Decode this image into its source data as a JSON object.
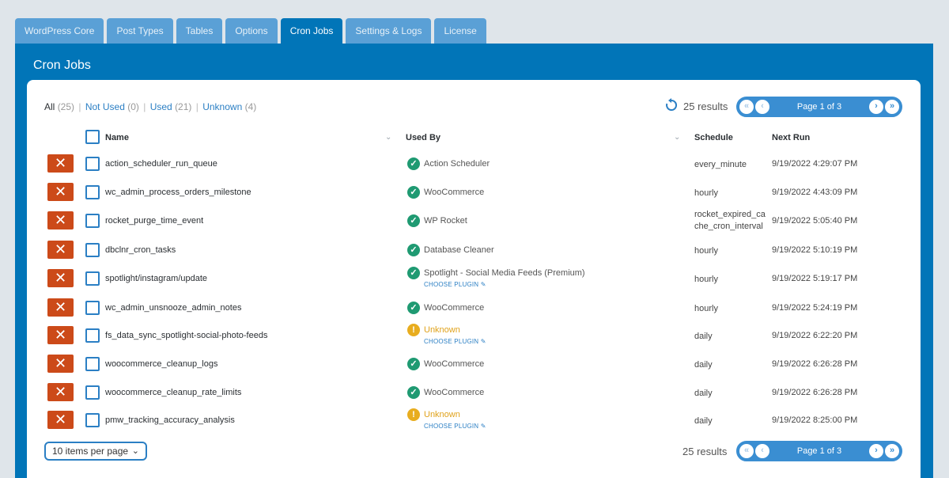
{
  "tabs": [
    {
      "label": "WordPress Core",
      "active": false
    },
    {
      "label": "Post Types",
      "active": false
    },
    {
      "label": "Tables",
      "active": false
    },
    {
      "label": "Options",
      "active": false
    },
    {
      "label": "Cron Jobs",
      "active": true
    },
    {
      "label": "Settings & Logs",
      "active": false
    },
    {
      "label": "License",
      "active": false
    }
  ],
  "panel": {
    "title": "Cron Jobs"
  },
  "filters": {
    "all": "All",
    "all_count": "(25)",
    "not_used": "Not Used",
    "not_used_count": "(0)",
    "used": "Used",
    "used_count": "(21)",
    "unknown": "Unknown",
    "unknown_count": "(4)",
    "sep": "|"
  },
  "results_text": "25 results",
  "pager": {
    "label": "Page 1 of 3",
    "first": "«",
    "prev": "‹",
    "next": "›",
    "last": "»"
  },
  "columns": {
    "name": "Name",
    "used_by": "Used By",
    "schedule": "Schedule",
    "next_run": "Next Run"
  },
  "choose_plugin_label": "CHOOSE PLUGIN ✎",
  "rows": [
    {
      "name": "action_scheduler_run_queue",
      "used_by": "Action Scheduler",
      "status": "ok",
      "schedule": "every_minute",
      "next_run": "9/19/2022 4:29:07 PM"
    },
    {
      "name": "wc_admin_process_orders_milestone",
      "used_by": "WooCommerce",
      "status": "ok",
      "schedule": "hourly",
      "next_run": "9/19/2022 4:43:09 PM"
    },
    {
      "name": "rocket_purge_time_event",
      "used_by": "WP Rocket",
      "status": "ok",
      "schedule": "rocket_expired_cache_cron_interval",
      "next_run": "9/19/2022 5:05:40 PM"
    },
    {
      "name": "dbclnr_cron_tasks",
      "used_by": "Database Cleaner",
      "status": "ok",
      "schedule": "hourly",
      "next_run": "9/19/2022 5:10:19 PM"
    },
    {
      "name": "spotlight/instagram/update",
      "used_by": "Spotlight - Social Media Feeds (Premium)",
      "status": "ok",
      "schedule": "hourly",
      "next_run": "9/19/2022 5:19:17 PM",
      "choose": true
    },
    {
      "name": "wc_admin_unsnooze_admin_notes",
      "used_by": "WooCommerce",
      "status": "ok",
      "schedule": "hourly",
      "next_run": "9/19/2022 5:24:19 PM"
    },
    {
      "name": "fs_data_sync_spotlight-social-photo-feeds",
      "used_by": "Unknown",
      "status": "unknown",
      "schedule": "daily",
      "next_run": "9/19/2022 6:22:20 PM",
      "choose": true
    },
    {
      "name": "woocommerce_cleanup_logs",
      "used_by": "WooCommerce",
      "status": "ok",
      "schedule": "daily",
      "next_run": "9/19/2022 6:26:28 PM"
    },
    {
      "name": "woocommerce_cleanup_rate_limits",
      "used_by": "WooCommerce",
      "status": "ok",
      "schedule": "daily",
      "next_run": "9/19/2022 6:26:28 PM"
    },
    {
      "name": "pmw_tracking_accuracy_analysis",
      "used_by": "Unknown",
      "status": "unknown",
      "schedule": "daily",
      "next_run": "9/19/2022 8:25:00 PM",
      "choose": true
    }
  ],
  "per_page": {
    "label": "10 items per page"
  },
  "icons": {
    "delete": "close-x",
    "ok": "check-circle",
    "unknown": "exclamation-circle",
    "refresh": "refresh"
  },
  "colors": {
    "accent": "#0175b8",
    "delete": "#cc4a19",
    "ok": "#1f9a72",
    "unknown": "#e8ad1f"
  }
}
